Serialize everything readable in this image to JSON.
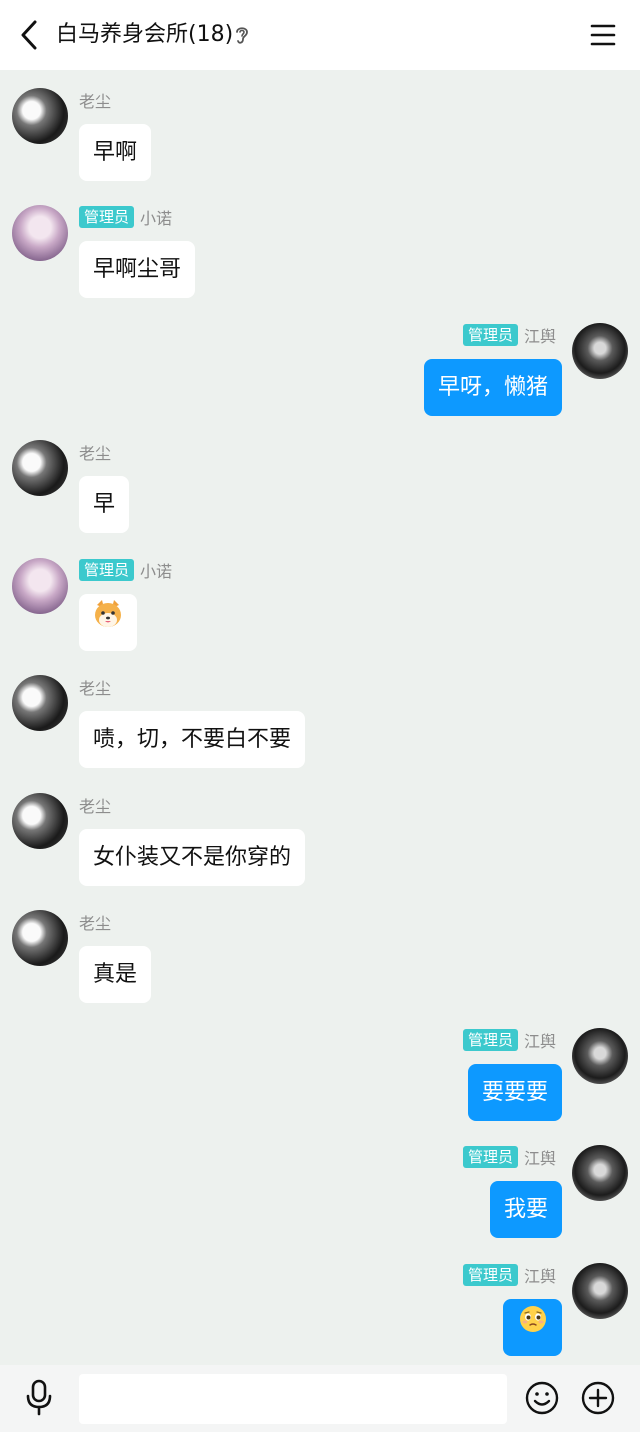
{
  "header": {
    "title": "白马养身会所(18)",
    "back_icon": "chevron-left-icon",
    "listen_icon": "ear-icon",
    "menu_icon": "hamburger-menu-icon"
  },
  "messages": [
    {
      "sender": "老尘",
      "role": "",
      "text": "早啊",
      "side": "left",
      "avatar": "laochen"
    },
    {
      "sender": "小诺",
      "role": "管理员",
      "text": "早啊尘哥",
      "side": "left",
      "avatar": "xiaonuo"
    },
    {
      "sender": "江舆",
      "role": "管理员",
      "text": "早呀，懒猪",
      "side": "right",
      "avatar": "jiangyu"
    },
    {
      "sender": "老尘",
      "role": "",
      "text": "早",
      "side": "left",
      "avatar": "laochen"
    },
    {
      "sender": "小诺",
      "role": "管理员",
      "text": "",
      "side": "left",
      "avatar": "xiaonuo",
      "emoji": "shiba-dog-emoji"
    },
    {
      "sender": "老尘",
      "role": "",
      "text": "啧，切，不要白不要",
      "side": "left",
      "avatar": "laochen"
    },
    {
      "sender": "老尘",
      "role": "",
      "text": "女仆装又不是你穿的",
      "side": "left",
      "avatar": "laochen"
    },
    {
      "sender": "老尘",
      "role": "",
      "text": "真是",
      "side": "left",
      "avatar": "laochen"
    },
    {
      "sender": "江舆",
      "role": "管理员",
      "text": "要要要",
      "side": "right",
      "avatar": "jiangyu"
    },
    {
      "sender": "江舆",
      "role": "管理员",
      "text": "我要",
      "side": "right",
      "avatar": "jiangyu"
    },
    {
      "sender": "江舆",
      "role": "管理员",
      "text": "",
      "side": "right",
      "avatar": "jiangyu",
      "emoji": "pleading-face-emoji"
    }
  ],
  "input_bar": {
    "placeholder": "",
    "mic_icon": "microphone-icon",
    "emoji_icon": "smiley-icon",
    "plus_icon": "plus-circle-icon"
  },
  "colors": {
    "background": "#edf1ee",
    "self_bubble": "#0d99ff",
    "other_bubble": "#ffffff",
    "admin_badge": "#3cc9cd"
  }
}
